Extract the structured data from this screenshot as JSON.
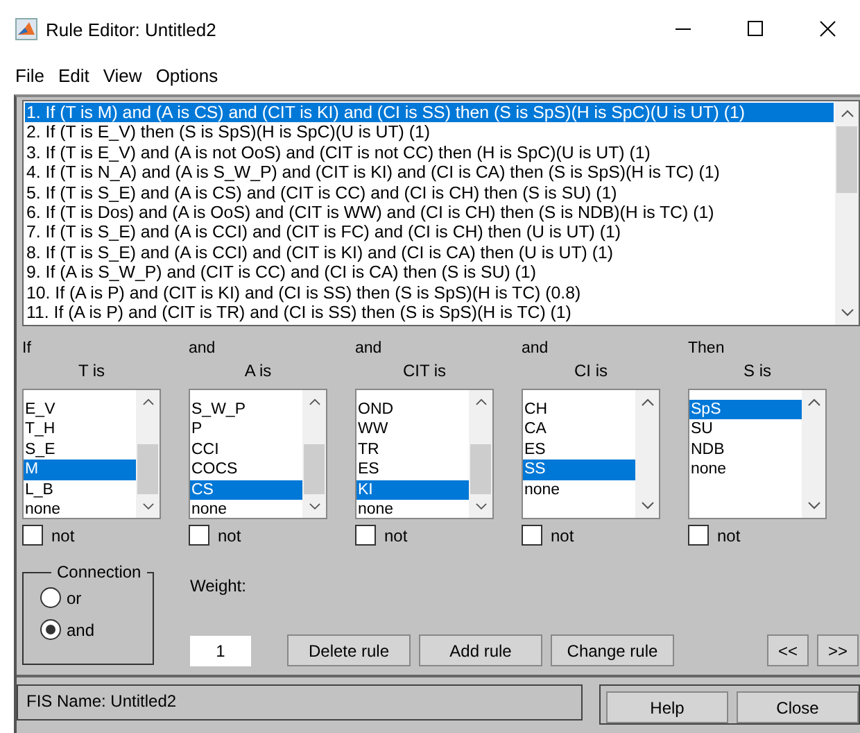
{
  "window": {
    "title": "Rule Editor: Untitled2"
  },
  "menu": [
    "File",
    "Edit",
    "View",
    "Options"
  ],
  "rules": [
    {
      "text": "1. If (T is M) and (A is CS) and (CIT is KI) and (CI is SS) then (S is SpS)(H is SpC)(U is UT) (1)",
      "selected": true
    },
    {
      "text": "2. If (T is E_V) then (S is SpS)(H is SpC)(U is UT) (1)",
      "selected": false
    },
    {
      "text": "3. If (T is E_V) and (A is not OoS) and (CIT is not CC) then (H is SpC)(U is UT) (1)",
      "selected": false
    },
    {
      "text": "4. If (T is N_A) and (A is S_W_P) and (CIT is KI) and (CI is CA) then (S is SpS)(H is TC) (1)",
      "selected": false
    },
    {
      "text": "5. If (T is S_E) and (A is CS) and (CIT is CC) and (CI is CH) then (S is SU) (1)",
      "selected": false
    },
    {
      "text": "6. If (T is Dos) and (A is OoS) and (CIT is WW) and (CI is CH) then (S is NDB)(H is TC) (1)",
      "selected": false
    },
    {
      "text": "7. If (T is S_E) and (A is CCI) and (CIT is FC) and (CI is CH) then (U is UT) (1)",
      "selected": false
    },
    {
      "text": "8. If (T is S_E) and (A is CCI) and (CIT is KI) and (CI is CA) then (U is UT) (1)",
      "selected": false
    },
    {
      "text": "9. If (A is S_W_P) and (CIT is CC) and (CI is CA) then (S is SU) (1)",
      "selected": false
    },
    {
      "text": "10. If (A is P) and (CIT is KI) and (CI is SS) then (S is SpS)(H is TC) (0.8)",
      "selected": false
    },
    {
      "text": "11. If (A is P) and (CIT is TR) and (CI is SS) then (S is SpS)(H is TC) (1)",
      "selected": false
    }
  ],
  "columns": [
    {
      "connector": "If",
      "label": "T is",
      "scrollbar": true,
      "not": false,
      "not_label": "not",
      "items": [
        {
          "text": "E_V",
          "selected": false
        },
        {
          "text": "T_H",
          "selected": false
        },
        {
          "text": "S_E",
          "selected": false
        },
        {
          "text": "M",
          "selected": true
        },
        {
          "text": "L_B",
          "selected": false
        },
        {
          "text": "none",
          "selected": false
        }
      ]
    },
    {
      "connector": "and",
      "label": "A is",
      "scrollbar": true,
      "not": false,
      "not_label": "not",
      "items": [
        {
          "text": "S_W_P",
          "selected": false
        },
        {
          "text": "P",
          "selected": false
        },
        {
          "text": "CCI",
          "selected": false
        },
        {
          "text": "COCS",
          "selected": false
        },
        {
          "text": "CS",
          "selected": true
        },
        {
          "text": "none",
          "selected": false
        }
      ]
    },
    {
      "connector": "and",
      "label": "CIT is",
      "scrollbar": true,
      "not": false,
      "not_label": "not",
      "items": [
        {
          "text": "OND",
          "selected": false
        },
        {
          "text": "WW",
          "selected": false
        },
        {
          "text": "TR",
          "selected": false
        },
        {
          "text": "ES",
          "selected": false
        },
        {
          "text": "KI",
          "selected": true
        },
        {
          "text": "none",
          "selected": false
        }
      ]
    },
    {
      "connector": "and",
      "label": "CI is",
      "scrollbar": false,
      "not": false,
      "not_label": "not",
      "items": [
        {
          "text": "CH",
          "selected": false
        },
        {
          "text": "CA",
          "selected": false
        },
        {
          "text": "ES",
          "selected": false
        },
        {
          "text": "SS",
          "selected": true
        },
        {
          "text": "none",
          "selected": false
        }
      ]
    },
    {
      "connector": "Then",
      "label": "S is",
      "scrollbar": false,
      "not": false,
      "not_label": "not",
      "items": [
        {
          "text": "SpS",
          "selected": true
        },
        {
          "text": "SU",
          "selected": false
        },
        {
          "text": "NDB",
          "selected": false
        },
        {
          "text": "none",
          "selected": false
        }
      ]
    }
  ],
  "connection": {
    "title": "Connection",
    "options": [
      {
        "label": "or",
        "selected": false
      },
      {
        "label": "and",
        "selected": true
      }
    ]
  },
  "weight": {
    "label": "Weight:",
    "value": "1"
  },
  "actions": [
    "Delete rule",
    "Add rule",
    "Change rule"
  ],
  "nav": [
    "<<",
    ">>"
  ],
  "status": "FIS Name: Untitled2",
  "footer_buttons": [
    "Help",
    "Close"
  ]
}
